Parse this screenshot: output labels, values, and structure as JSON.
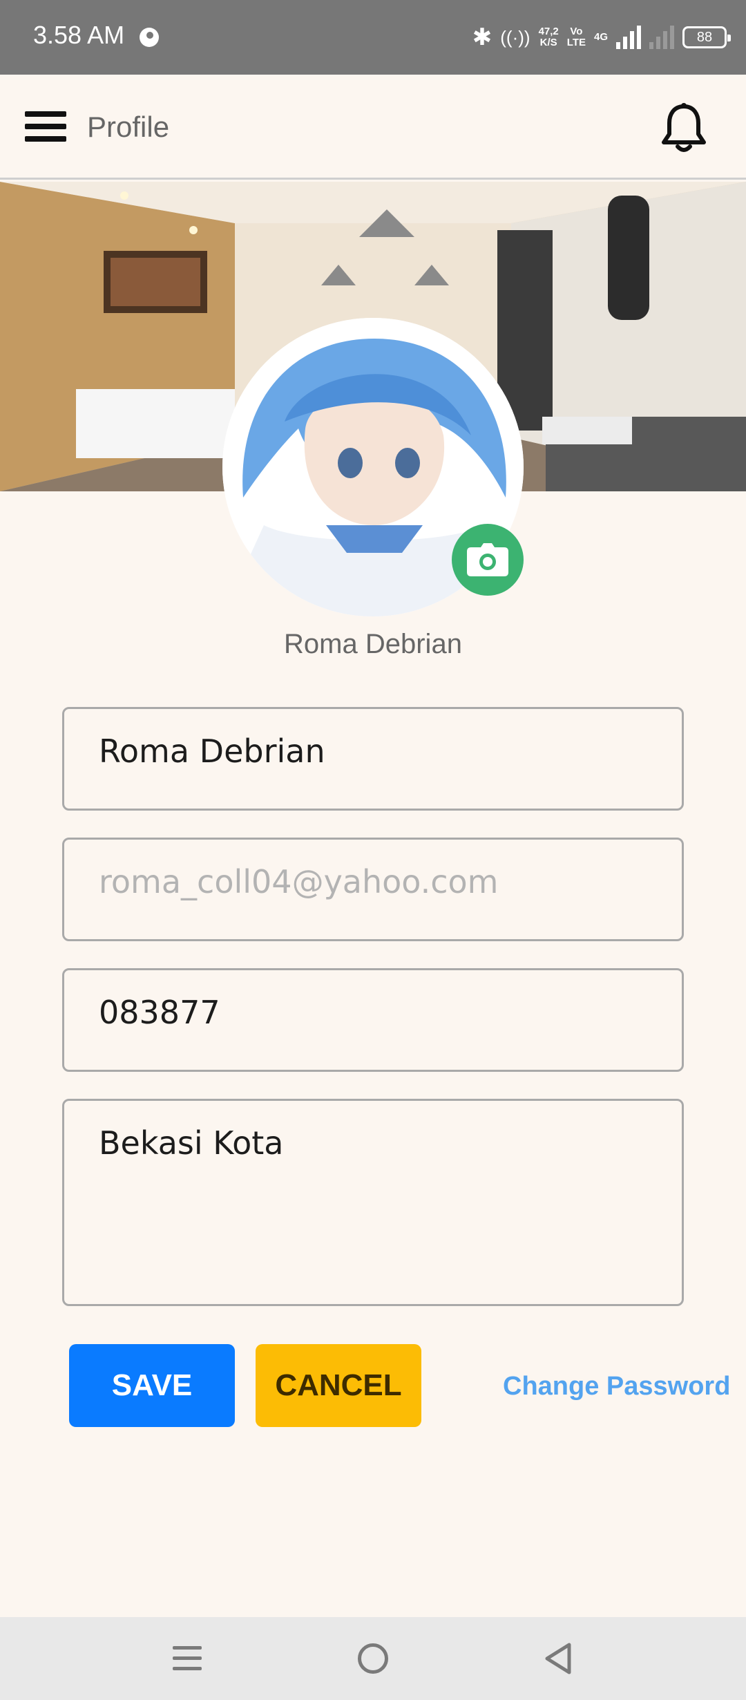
{
  "status_bar": {
    "time": "3.58 AM",
    "speed_value": "47,2",
    "speed_unit": "K/S",
    "volte_top": "Vo",
    "volte_bottom": "LTE",
    "network": "4G",
    "battery": "88"
  },
  "app_bar": {
    "title": "Profile",
    "menu_icon": "hamburger-menu-icon",
    "notification_icon": "bell-icon"
  },
  "profile": {
    "display_name": "Roma Debrian",
    "camera_icon": "camera-icon"
  },
  "form": {
    "name_value": "Roma Debrian",
    "email_placeholder": "roma_coll04@yahoo.com",
    "phone_value": "083877",
    "address_value": "Bekasi Kota"
  },
  "actions": {
    "save_label": "SAVE",
    "cancel_label": "CANCEL",
    "change_password_label": "Change Password"
  },
  "colors": {
    "background": "#fcf6f0",
    "save": "#0a7bff",
    "cancel": "#fcbc05",
    "link": "#53a3ef",
    "camera": "#3cb371"
  },
  "nav_bar": {
    "icons": [
      "recents-icon",
      "home-icon",
      "back-icon"
    ]
  }
}
